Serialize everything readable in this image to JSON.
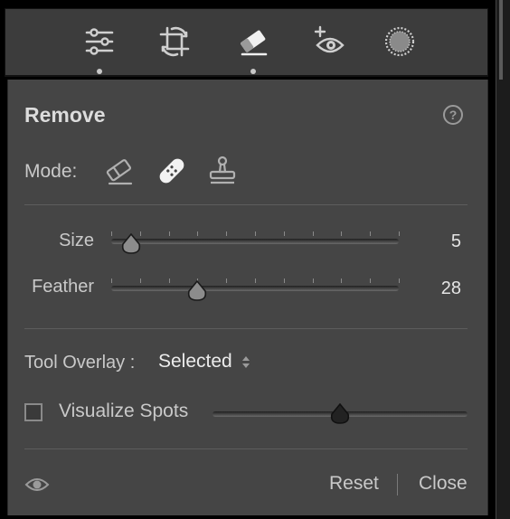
{
  "toolstrip": {
    "tools": [
      {
        "name": "edit",
        "icon": "sliders-icon"
      },
      {
        "name": "crop",
        "icon": "crop-rotate-icon"
      },
      {
        "name": "remove",
        "icon": "eraser-icon",
        "active": true
      },
      {
        "name": "red-eye",
        "icon": "red-eye-icon"
      },
      {
        "name": "masking",
        "icon": "masking-icon"
      }
    ],
    "dot_under": [
      "edit",
      "remove"
    ]
  },
  "panel": {
    "title": "Remove",
    "help_icon": "?",
    "mode_label": "Mode:",
    "modes": [
      {
        "name": "content-aware-remove",
        "icon": "eraser-icon"
      },
      {
        "name": "heal",
        "icon": "bandage-icon",
        "selected": true
      },
      {
        "name": "clone",
        "icon": "stamp-icon"
      }
    ],
    "sliders": [
      {
        "label": "Size",
        "value": "5",
        "level": 0.07
      },
      {
        "label": "Feather",
        "value": "28",
        "level": 0.3
      }
    ],
    "tool_overlay": {
      "label": "Tool Overlay :",
      "value": "Selected"
    },
    "visualize_spots": {
      "label": "Visualize Spots",
      "checked": false,
      "level": 0.5
    },
    "footer": {
      "reset": "Reset",
      "close": "Close"
    }
  },
  "colors": {
    "panel_bg": "#454545",
    "toolstrip_bg": "#3c3c3c",
    "text": "#c9c9c9"
  }
}
